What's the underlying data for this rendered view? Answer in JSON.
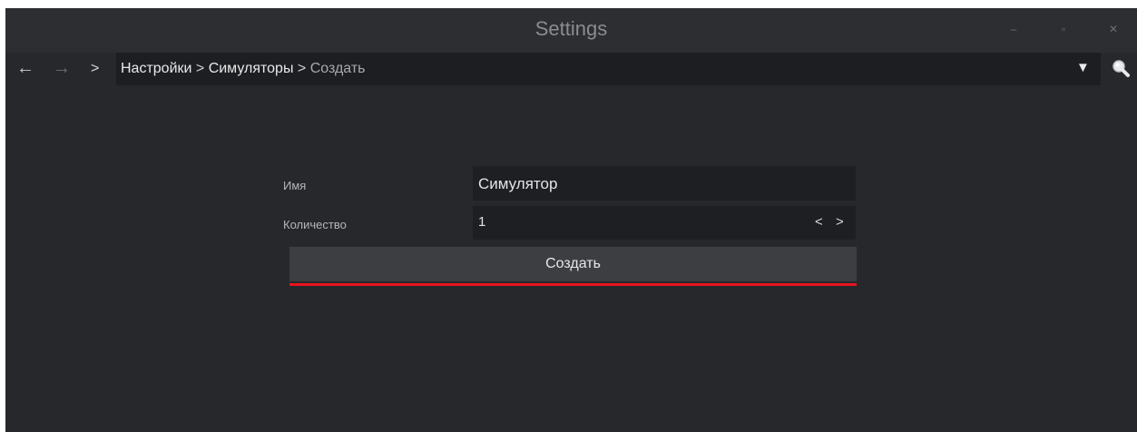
{
  "window": {
    "title": "Settings",
    "minimize_glyph": "–",
    "maximize_glyph": "▫",
    "close_glyph": "✕"
  },
  "nav": {
    "back_glyph": "←",
    "forward_glyph": "→",
    "chevron_glyph": ">",
    "breadcrumb": {
      "item1": "Настройки",
      "sep1": " > ",
      "item2": "Симуляторы",
      "sep2": " > ",
      "item3": "Создать"
    },
    "dropdown_glyph": "▼",
    "icons": {
      "search": "search-icon"
    }
  },
  "form": {
    "name_label": "Имя",
    "name_value": "Симулятор",
    "qty_label": "Количество",
    "qty_value": "1",
    "qty_dec_glyph": "<",
    "qty_inc_glyph": ">",
    "create_label": "Создать"
  },
  "colors": {
    "background": "#26282b",
    "input_bg": "#1d1f22",
    "button_bg": "#3c3e41",
    "accent": "#e8131f"
  }
}
